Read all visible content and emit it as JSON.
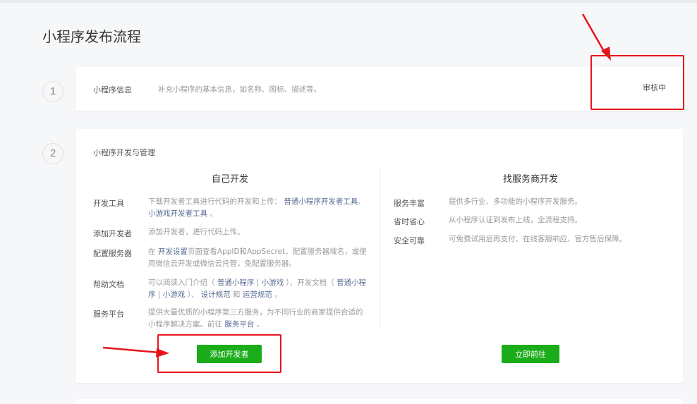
{
  "page": {
    "title": "小程序发布流程"
  },
  "steps": [
    {
      "number": "1"
    },
    {
      "number": "2"
    }
  ],
  "info_card": {
    "title": "小程序信息",
    "description": "补充小程序的基本信息，如名称、图标、描述等。",
    "status": "审核中"
  },
  "dev_card": {
    "title": "小程序开发与管理",
    "self_dev": {
      "heading": "自己开发",
      "rows": [
        {
          "label": "开发工具",
          "parts": [
            "下载开发者工具进行代码的开发和上传：",
            "普通小程序开发者工具",
            "、",
            "小游戏开发者工具",
            "。"
          ]
        },
        {
          "label": "添加开发者",
          "parts": [
            "添加开发者，进行代码上传。"
          ]
        },
        {
          "label": "配置服务器",
          "parts": [
            "在",
            "开发设置",
            "页面查看AppID和AppSecret，配置服务器域名，或使用微信云开发或微信云托管，免配置服务器。"
          ]
        },
        {
          "label": "帮助文档",
          "parts": [
            "可以阅读入门介绍（",
            "普通小程序",
            "|",
            "小游戏",
            "）、开发文档（",
            "普通小程序",
            "|",
            "小游戏",
            "）、",
            "设计规范",
            "和",
            "运营规范",
            "。"
          ]
        },
        {
          "label": "服务平台",
          "parts": [
            "提供大量优质的小程序第三方服务，为不同行业的商家提供合适的小程序解决方案。前往",
            "服务平台",
            "。"
          ]
        }
      ],
      "button": "添加开发者"
    },
    "vendor_dev": {
      "heading": "找服务商开发",
      "rows": [
        {
          "label": "服务丰富",
          "text": "提供多行业、多功能的小程序开发服务。"
        },
        {
          "label": "省时省心",
          "text": "从小程序认证到发布上线，全流程支持。"
        },
        {
          "label": "安全可靠",
          "text": "可免费试用后再支付、在线客服响应、官方售后保障。"
        }
      ],
      "button": "立即前往"
    }
  },
  "colors": {
    "accent_green": "#1aad19",
    "annotation_red": "#e8141c",
    "link_blue": "#576b95",
    "page_bg": "#f6f7f9"
  }
}
